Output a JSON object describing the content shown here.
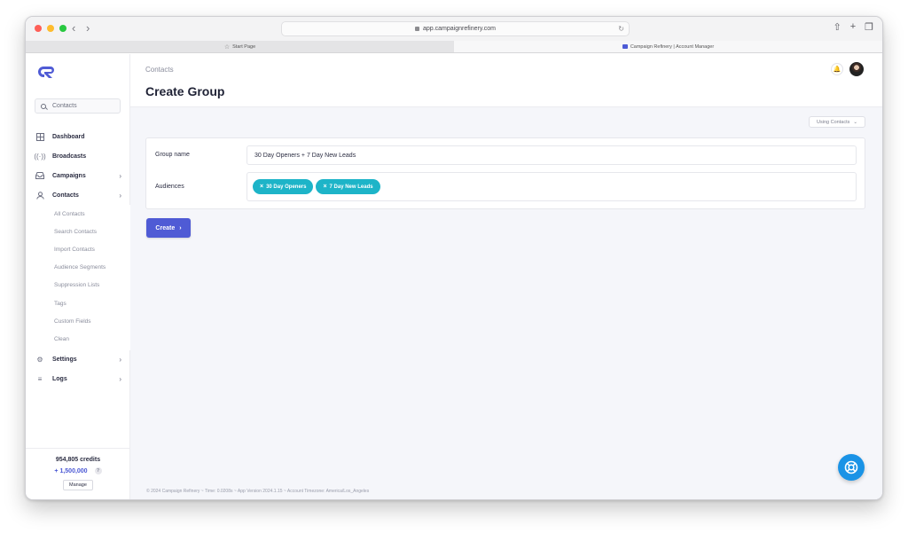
{
  "browser": {
    "url": "app.campaignrefinery.com",
    "tabs": [
      {
        "label": "Start Page",
        "active": false
      },
      {
        "label": "Campaign Refinery | Account Manager",
        "active": true
      }
    ]
  },
  "sidebar": {
    "search_placeholder": "Contacts",
    "items": [
      {
        "label": "Dashboard",
        "icon": "grid-icon"
      },
      {
        "label": "Broadcasts",
        "icon": "broadcast-icon"
      },
      {
        "label": "Campaigns",
        "icon": "inbox-icon"
      },
      {
        "label": "Contacts",
        "icon": "user-icon"
      },
      {
        "label": "Settings",
        "icon": "gear-icon"
      },
      {
        "label": "Logs",
        "icon": "list-icon"
      }
    ],
    "contacts_submenu": [
      "All Contacts",
      "Search Contacts",
      "Import Contacts",
      "Audience Segments",
      "Suppression Lists",
      "Tags",
      "Custom Fields",
      "Clean"
    ],
    "credits": "954,805 credits",
    "plus_credits": "+ 1,500,000",
    "help": "?",
    "manage_label": "Manage"
  },
  "header": {
    "breadcrumb": "Contacts",
    "title": "Create Group"
  },
  "form": {
    "using_label": "Using Contacts",
    "group_name_label": "Group name",
    "group_name_value": "30 Day Openers + 7 Day New Leads",
    "audiences_label": "Audiences",
    "audiences": [
      "30 Day Openers",
      "7 Day New Leads"
    ],
    "create_label": "Create"
  },
  "footer": {
    "text": "© 2024 Campaign Refinery ~ Time: 0.0208s ~ App Version 2024.1.15 ~ Account Timezone: America/Los_Angeles"
  },
  "colors": {
    "accent": "#4f5bd5",
    "chip": "#1db4c8",
    "fab": "#1a93e6"
  }
}
